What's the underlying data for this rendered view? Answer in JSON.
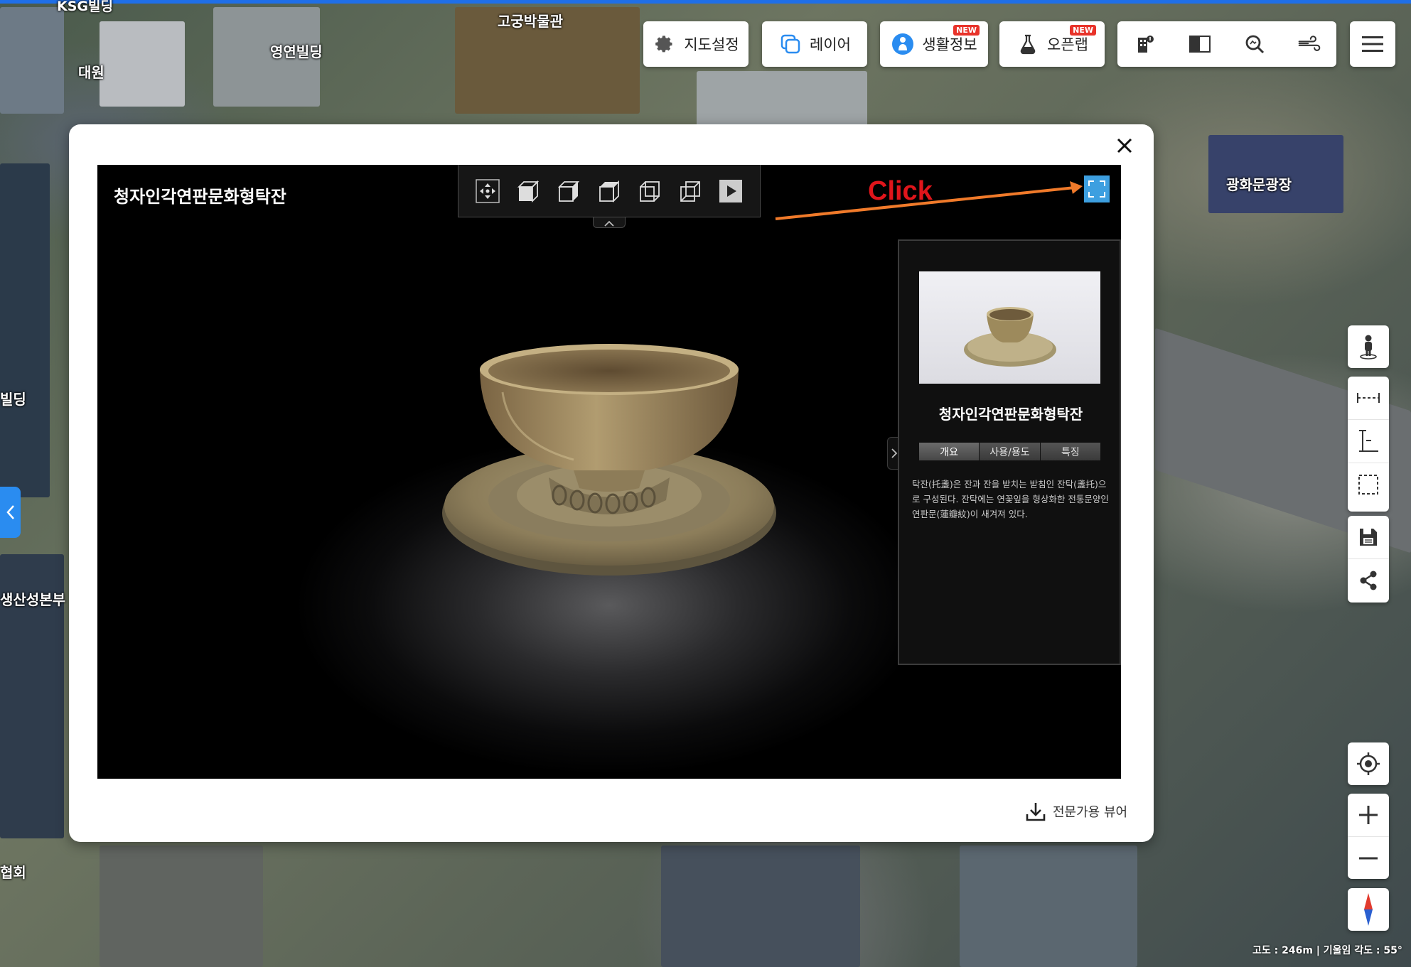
{
  "map": {
    "labels": [
      "KSG빌딩",
      "고궁박물관",
      "영연빌딩",
      "대원",
      "광화문광장",
      "빌딩",
      "생산성본부",
      "협회"
    ],
    "status": "고도 : 246m | 기울임 각도 : 55°"
  },
  "toolbar": {
    "map_settings": "지도설정",
    "layers": "레이어",
    "living_info": "생활정보",
    "open_lab": "오픈랩",
    "new_badge": "NEW"
  },
  "modal": {
    "viewer_title": "청자인각연판문화형탁잔",
    "annotation": "Click",
    "panel": {
      "title": "청자인각연판문화형탁잔",
      "tabs": [
        "개요",
        "사용/용도",
        "특징"
      ],
      "description": "탁잔(托盞)은 잔과 잔을 받치는 받침인 잔탁(盞托)으로 구성된다. 잔탁에는 연꽃잎을 형상화한 전통문양인 연판문(蓮瓣紋)이 새겨져 있다."
    },
    "download_label": "전문가용 뷰어"
  },
  "colors": {
    "accent": "#1f6fe8",
    "fullscreen_button": "#3d9fe0",
    "annotation": "#e0151b",
    "arrow": "#f07a2a",
    "new_badge": "#e8332a"
  }
}
